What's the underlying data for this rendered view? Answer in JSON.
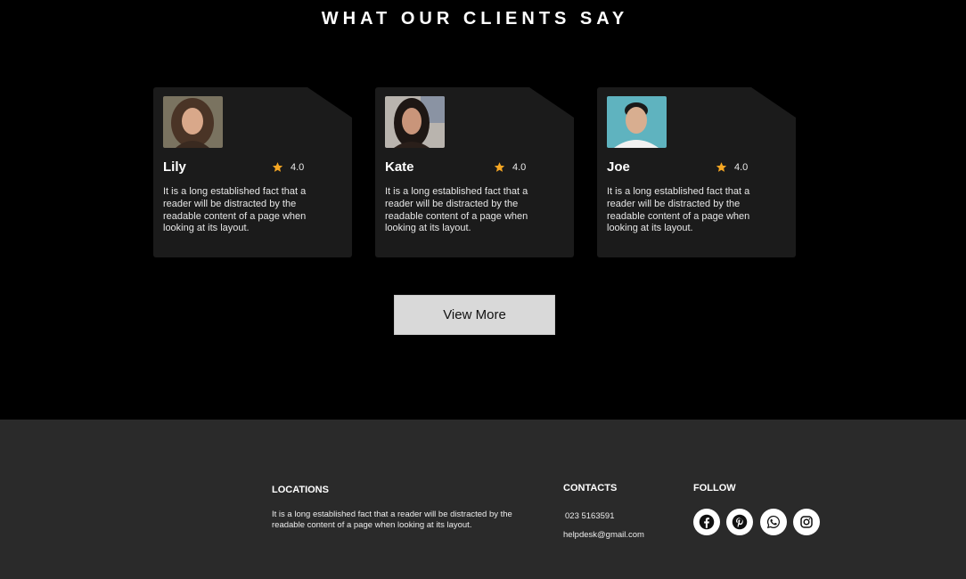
{
  "section_title": "WHAT OUR CLIENTS SAY",
  "testimonials": [
    {
      "name": "Lily",
      "rating": "4.0",
      "text": "It is a long established fact that a reader will be distracted by the readable content of a page when looking at its layout."
    },
    {
      "name": "Kate",
      "rating": "4.0",
      "text": "It is a long established fact that a reader will be distracted by the readable content of a page when looking at its layout."
    },
    {
      "name": "Joe",
      "rating": "4.0",
      "text": "It is a long established fact that a reader will be distracted by the readable content of a page when looking at its layout."
    }
  ],
  "view_more_label": "View More",
  "footer": {
    "locations_title": "LOCATIONS",
    "locations_text": "It is a long established fact that a reader will be distracted by the readable content of a page when looking at its layout.",
    "contacts_title": "CONTACTS",
    "phone": "023 5163591",
    "email": "helpdesk@gmail.com",
    "follow_title": "FOLLOW",
    "social_icons": [
      "facebook-icon",
      "pinterest-icon",
      "whatsapp-icon",
      "instagram-icon"
    ]
  },
  "colors": {
    "background": "#000000",
    "card": "#1b1b1b",
    "star": "#f5a623",
    "footer": "#2a2a2a",
    "button": "#d9d9d9"
  }
}
